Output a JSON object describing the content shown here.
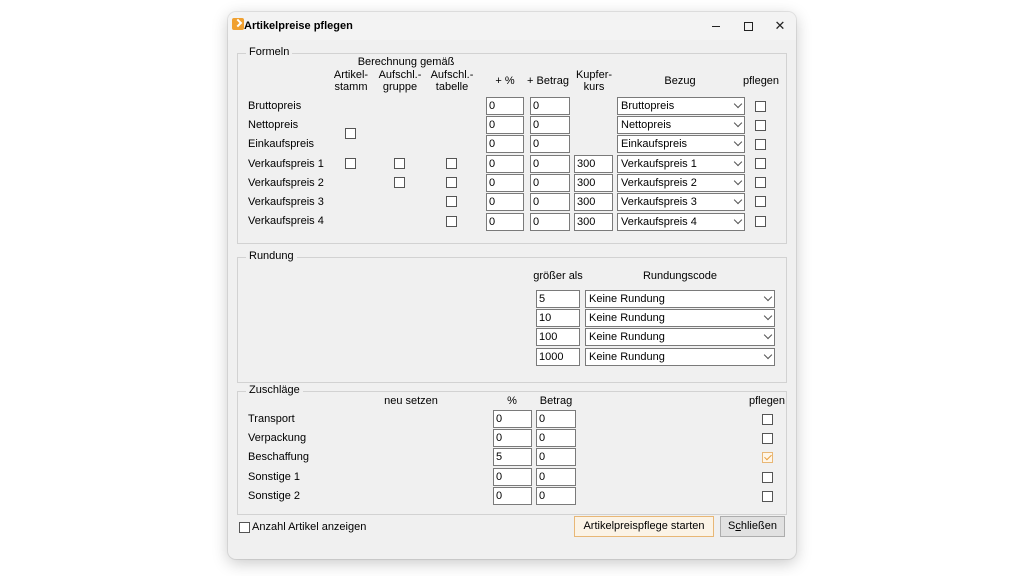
{
  "window": {
    "title": "Artikelpreise pflegen"
  },
  "formeln": {
    "title": "Formeln",
    "headers": {
      "berechnung": "Berechnung gemäß",
      "artikelstamm": [
        "Artikel-",
        "stamm"
      ],
      "aufschl_gruppe": [
        "Aufschl.-",
        "gruppe"
      ],
      "aufschl_tabelle": [
        "Aufschl.-",
        "tabelle"
      ],
      "plus_pct": "+ %",
      "plus_betrag": "+ Betrag",
      "kupferkurs": [
        "Kupfer-",
        "kurs"
      ],
      "bezug": "Bezug",
      "pflegen": "pflegen"
    },
    "rows": [
      {
        "label": "Bruttopreis",
        "pct": "0",
        "betrag": "0",
        "kupfer": "",
        "bezug": "Bruttopreis"
      },
      {
        "label": "Nettopreis",
        "pct": "0",
        "betrag": "0",
        "kupfer": "",
        "bezug": "Nettopreis"
      },
      {
        "label": "Einkaufspreis",
        "pct": "0",
        "betrag": "0",
        "kupfer": "",
        "bezug": "Einkaufspreis"
      },
      {
        "label": "Verkaufspreis 1",
        "pct": "0",
        "betrag": "0",
        "kupfer": "300",
        "bezug": "Verkaufspreis 1"
      },
      {
        "label": "Verkaufspreis 2",
        "pct": "0",
        "betrag": "0",
        "kupfer": "300",
        "bezug": "Verkaufspreis 2"
      },
      {
        "label": "Verkaufspreis 3",
        "pct": "0",
        "betrag": "0",
        "kupfer": "300",
        "bezug": "Verkaufspreis 3"
      },
      {
        "label": "Verkaufspreis 4",
        "pct": "0",
        "betrag": "0",
        "kupfer": "300",
        "bezug": "Verkaufspreis 4"
      }
    ]
  },
  "rundung": {
    "title": "Rundung",
    "headers": {
      "groesser_als": "größer als",
      "rundungscode": "Rundungscode"
    },
    "rows": [
      {
        "value": "5",
        "code": "Keine Rundung"
      },
      {
        "value": "10",
        "code": "Keine Rundung"
      },
      {
        "value": "100",
        "code": "Keine Rundung"
      },
      {
        "value": "1000",
        "code": "Keine Rundung"
      }
    ]
  },
  "zuschlaege": {
    "title": "Zuschläge",
    "headers": {
      "neu_setzen": "neu setzen",
      "pct": "%",
      "betrag": "Betrag",
      "pflegen": "pflegen"
    },
    "rows": [
      {
        "label": "Transport",
        "pct": "0",
        "betrag": "0"
      },
      {
        "label": "Verpackung",
        "pct": "0",
        "betrag": "0"
      },
      {
        "label": "Beschaffung",
        "pct": "5",
        "betrag": "0"
      },
      {
        "label": "Sonstige 1",
        "pct": "0",
        "betrag": "0"
      },
      {
        "label": "Sonstige 2",
        "pct": "0",
        "betrag": "0"
      }
    ]
  },
  "footer": {
    "anzahl_label": "Anzahl Artikel anzeigen",
    "start_button": "Artikelpreispflege starten",
    "close_button_prefix": "S",
    "close_button_accel": "c",
    "close_button_rest": "hließen"
  }
}
